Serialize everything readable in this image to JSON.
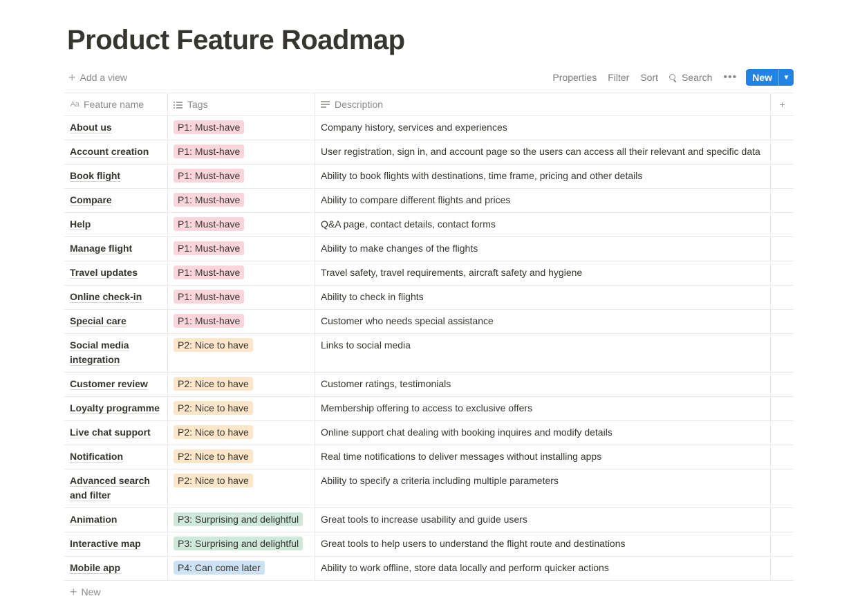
{
  "page": {
    "title": "Product Feature Roadmap"
  },
  "toolbar": {
    "add_view": "Add a view",
    "properties": "Properties",
    "filter": "Filter",
    "sort": "Sort",
    "search": "Search",
    "new": "New"
  },
  "columns": {
    "name": "Feature name",
    "tags": "Tags",
    "description": "Description"
  },
  "tag_colors": {
    "P1: Must-have": "#fbd5dc",
    "P2: Nice to have": "#fbe6c9",
    "P3: Surprising and delightful": "#cfe8dc",
    "P4: Can come later": "#cde3f5"
  },
  "rows": [
    {
      "name": "About us",
      "tag": "P1: Must-have",
      "description": "Company history, services and experiences"
    },
    {
      "name": "Account creation",
      "tag": "P1: Must-have",
      "description": "User registration, sign in, and account page so the users can access all their relevant and specific data"
    },
    {
      "name": "Book flight",
      "tag": "P1: Must-have",
      "description": "Ability to book flights with destinations, time frame, pricing and other details"
    },
    {
      "name": "Compare",
      "tag": "P1: Must-have",
      "description": "Ability to compare different flights and prices"
    },
    {
      "name": "Help",
      "tag": "P1: Must-have",
      "description": "Q&A page, contact details, contact forms"
    },
    {
      "name": "Manage flight",
      "tag": "P1: Must-have",
      "description": "Ability to make changes of the flights"
    },
    {
      "name": "Travel updates",
      "tag": "P1: Must-have",
      "description": "Travel safety, travel requirements, aircraft safety and hygiene"
    },
    {
      "name": "Online check-in",
      "tag": "P1: Must-have",
      "description": "Ability to check in flights"
    },
    {
      "name": "Special care",
      "tag": "P1: Must-have",
      "description": "Customer who needs special assistance"
    },
    {
      "name": "Social media integration",
      "tag": "P2: Nice to have",
      "description": "Links to social media"
    },
    {
      "name": "Customer review",
      "tag": "P2: Nice to have",
      "description": "Customer ratings, testimonials"
    },
    {
      "name": "Loyalty programme",
      "tag": "P2: Nice to have",
      "description": "Membership offering to access to exclusive offers"
    },
    {
      "name": "Live chat support",
      "tag": "P2: Nice to have",
      "description": "Online support chat dealing with booking inquires and modify details"
    },
    {
      "name": "Notification",
      "tag": "P2: Nice to have",
      "description": "Real time notifications to deliver messages without installing apps"
    },
    {
      "name": "Advanced search and filter",
      "tag": "P2: Nice to have",
      "description": "Ability to specify a criteria including multiple parameters"
    },
    {
      "name": "Animation",
      "tag": "P3: Surprising and delightful",
      "description": "Great tools to increase usability and guide users"
    },
    {
      "name": "Interactive map",
      "tag": "P3: Surprising and delightful",
      "description": "Great tools to help users to understand the flight route and destinations"
    },
    {
      "name": "Mobile app",
      "tag": "P4: Can come later",
      "description": "Ability to work offline, store data locally and perform quicker actions"
    }
  ],
  "footer": {
    "new_row": "New"
  }
}
